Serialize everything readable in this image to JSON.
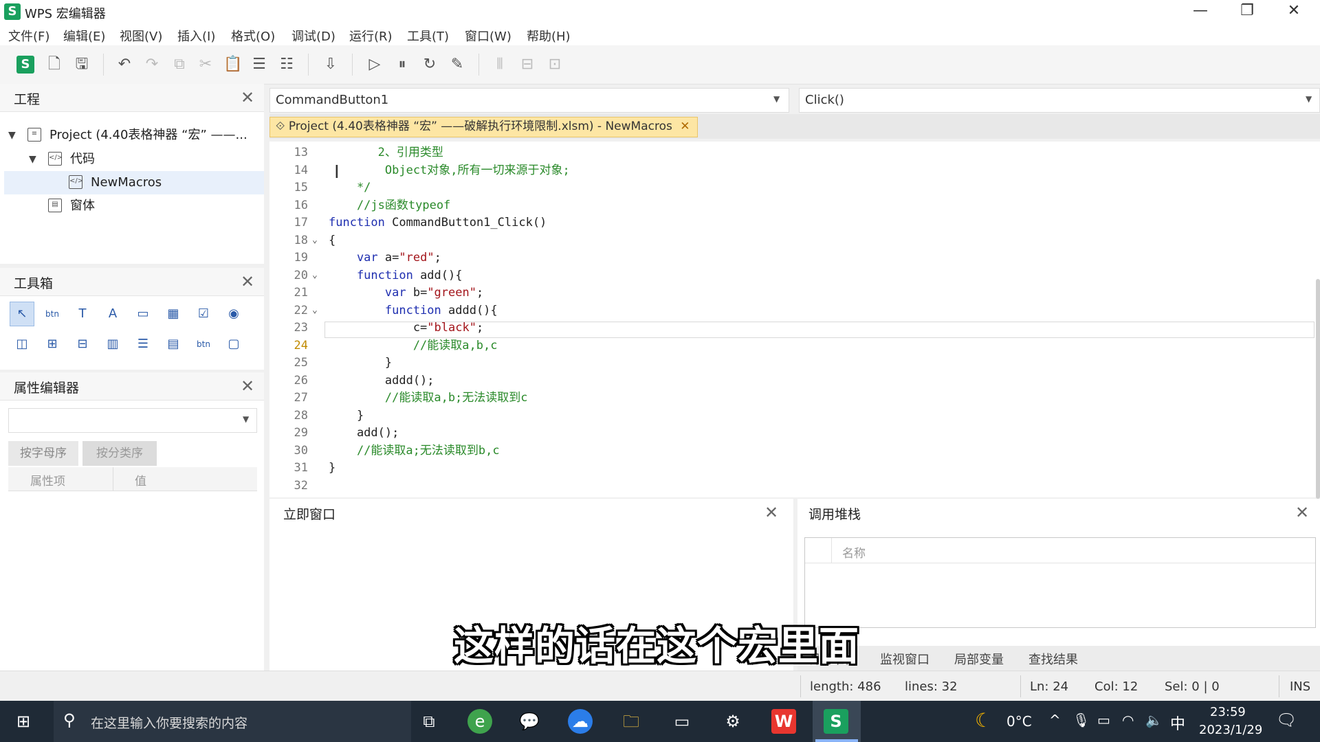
{
  "window": {
    "title": "WPS 宏编辑器",
    "logo": "S",
    "min": "—",
    "restore": "❐",
    "close": "✕"
  },
  "menu": [
    "文件(F)",
    "编辑(E)",
    "视图(V)",
    "插入(I)",
    "格式(O)",
    "调试(D)",
    "运行(R)",
    "工具(T)",
    "窗口(W)",
    "帮助(H)"
  ],
  "project_panel": {
    "title": "工程",
    "root": "Project (4.40表格神器 “宏” ——...",
    "code_folder": "代码",
    "module": "NewMacros",
    "forms_folder": "窗体"
  },
  "toolbox_panel": {
    "title": "工具箱"
  },
  "property_panel": {
    "title": "属性编辑器",
    "tab_alpha": "按字母序",
    "tab_category": "按分类序",
    "col_item": "属性项",
    "col_value": "值"
  },
  "editor": {
    "object_combo": "CommandButton1",
    "proc_combo": "Click()",
    "file_tab": "Project (4.40表格神器 “宏” ——破解执行环境限制.xlsm) - NewMacros",
    "current_line": "24"
  },
  "code_lines": [
    {
      "n": "13",
      "parts": [
        {
          "c": "cm",
          "t": "       2、引用类型"
        }
      ]
    },
    {
      "n": "14",
      "parts": [
        {
          "c": "cm",
          "t": "        Object对象,所有一切来源于对象;"
        }
      ]
    },
    {
      "n": "15",
      "parts": [
        {
          "c": "cm",
          "t": "    */"
        }
      ]
    },
    {
      "n": "16",
      "parts": [
        {
          "c": "cm",
          "t": "    //js函数typeof"
        }
      ]
    },
    {
      "n": "17",
      "parts": [
        {
          "c": "kw",
          "t": "function "
        },
        {
          "c": "pl",
          "t": "CommandButton1_Click()"
        }
      ]
    },
    {
      "n": "18",
      "parts": [
        {
          "c": "pl",
          "t": "{"
        }
      ]
    },
    {
      "n": "19",
      "parts": [
        {
          "c": "kw",
          "t": "    var "
        },
        {
          "c": "pl",
          "t": "a="
        },
        {
          "c": "str",
          "t": "\"red\""
        },
        {
          "c": "pl",
          "t": ";"
        }
      ]
    },
    {
      "n": "20",
      "parts": [
        {
          "c": "kw",
          "t": "    function "
        },
        {
          "c": "pl",
          "t": "add(){"
        }
      ]
    },
    {
      "n": "21",
      "parts": [
        {
          "c": "kw",
          "t": "        var "
        },
        {
          "c": "pl",
          "t": "b="
        },
        {
          "c": "str",
          "t": "\"green\""
        },
        {
          "c": "pl",
          "t": ";"
        }
      ]
    },
    {
      "n": "22",
      "parts": [
        {
          "c": "kw",
          "t": "        function "
        },
        {
          "c": "pl",
          "t": "addd(){"
        }
      ]
    },
    {
      "n": "23",
      "parts": [
        {
          "c": "pl",
          "t": "            c="
        },
        {
          "c": "str",
          "t": "\"black\""
        },
        {
          "c": "pl",
          "t": ";"
        }
      ]
    },
    {
      "n": "24",
      "parts": [
        {
          "c": "cm",
          "t": "            //能读取a,b,c"
        }
      ]
    },
    {
      "n": "25",
      "parts": [
        {
          "c": "pl",
          "t": "        }"
        }
      ]
    },
    {
      "n": "26",
      "parts": [
        {
          "c": "pl",
          "t": "        addd();"
        }
      ]
    },
    {
      "n": "27",
      "parts": [
        {
          "c": "cm",
          "t": "        //能读取a,b;无法读取到c"
        }
      ]
    },
    {
      "n": "28",
      "parts": [
        {
          "c": "pl",
          "t": "    }"
        }
      ]
    },
    {
      "n": "29",
      "parts": [
        {
          "c": "pl",
          "t": "    add();"
        }
      ]
    },
    {
      "n": "30",
      "parts": [
        {
          "c": "cm",
          "t": "    //能读取a;无法读取到b,c"
        }
      ]
    },
    {
      "n": "31",
      "parts": [
        {
          "c": "pl",
          "t": "}"
        }
      ]
    },
    {
      "n": "32",
      "parts": [
        {
          "c": "pl",
          "t": ""
        }
      ]
    }
  ],
  "immediate_panel": {
    "title": "立即窗口"
  },
  "callstack_panel": {
    "title": "调用堆栈",
    "col_name": "名称",
    "tabs": [
      "调用堆栈",
      "监视窗口",
      "局部变量",
      "查找结果"
    ]
  },
  "status": {
    "length": "length: 486",
    "lines": "lines: 32",
    "ln": "Ln: 24",
    "col": "Col: 12",
    "sel": "Sel: 0 | 0",
    "ins": "INS"
  },
  "taskbar": {
    "search_placeholder": "在这里输入你要搜索的内容",
    "weather": "0°C",
    "ime": "中",
    "time": "23:59",
    "date": "2023/1/29"
  },
  "subtitle": "这样的话在这个宏里面",
  "colors": {
    "accent_green": "#1aa05e",
    "keyword": "#1f2fb0",
    "string": "#a3151b",
    "comment": "#2a8a2a"
  }
}
